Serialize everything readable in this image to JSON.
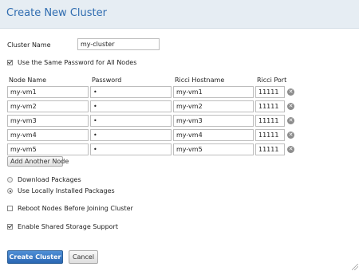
{
  "dialog": {
    "title": "Create New Cluster"
  },
  "cluster_name": {
    "label": "Cluster Name",
    "value": "my-cluster"
  },
  "same_password": {
    "label": "Use the Same Password for All Nodes",
    "checked": true
  },
  "table": {
    "headers": [
      "Node Name",
      "Password",
      "Ricci Hostname",
      "Ricci Port"
    ],
    "rows": [
      {
        "node": "my-vm1",
        "password": "•",
        "hostname": "my-vm1",
        "port": "11111"
      },
      {
        "node": "my-vm2",
        "password": "•",
        "hostname": "my-vm2",
        "port": "11111"
      },
      {
        "node": "my-vm3",
        "password": "•",
        "hostname": "my-vm3",
        "port": "11111"
      },
      {
        "node": "my-vm4",
        "password": "•",
        "hostname": "my-vm4",
        "port": "11111"
      },
      {
        "node": "my-vm5",
        "password": "•",
        "hostname": "my-vm5",
        "port": "11111"
      }
    ],
    "remove_icon": "remove-icon"
  },
  "add_node_label": "Add Another Node",
  "packages": {
    "options": [
      {
        "label": "Download Packages",
        "selected": false
      },
      {
        "label": "Use Locally Installed Packages",
        "selected": true
      }
    ]
  },
  "reboot": {
    "label": "Reboot Nodes Before Joining Cluster",
    "checked": false
  },
  "shared_storage": {
    "label": "Enable Shared Storage Support",
    "checked": true
  },
  "buttons": {
    "create": "Create Cluster",
    "cancel": "Cancel"
  }
}
